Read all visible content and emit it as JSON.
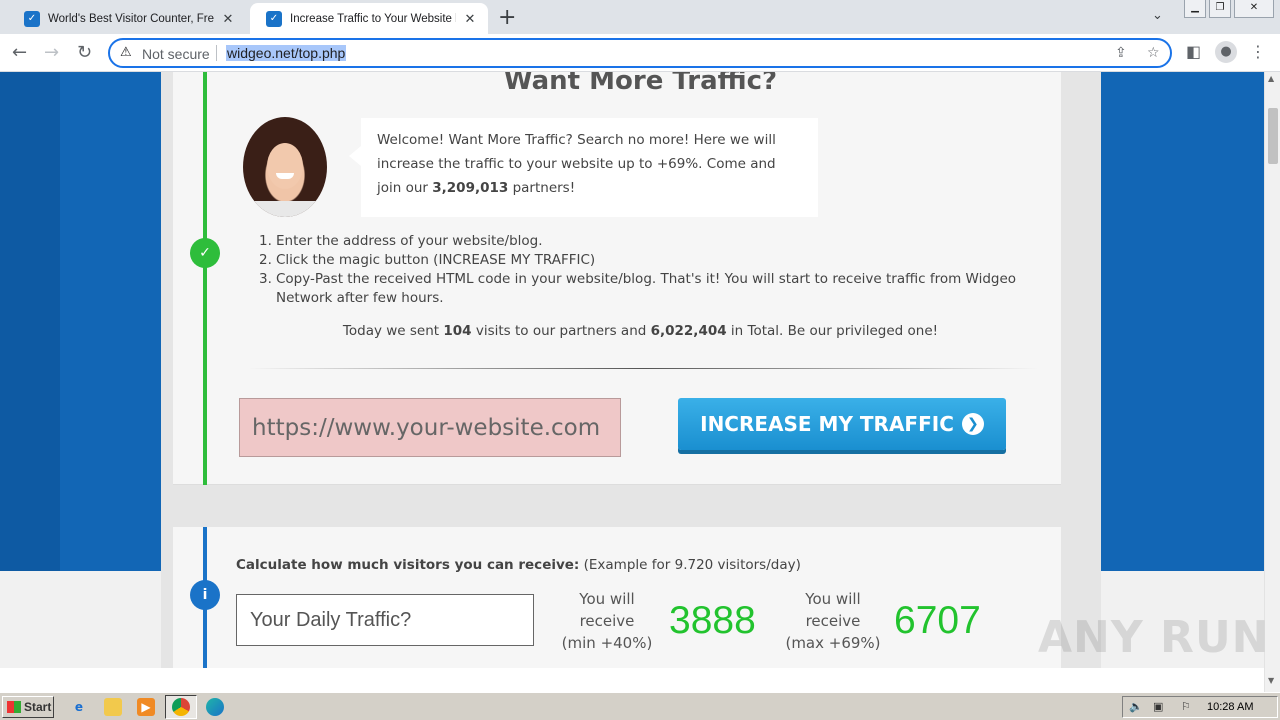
{
  "browser": {
    "tabs": [
      {
        "title": "World's Best Visitor Counter, Free hi",
        "active": false
      },
      {
        "title": "Increase Traffic to Your Website by",
        "active": true
      }
    ],
    "new_tab_label": "+",
    "security_label": "Not secure",
    "url": "widgeo.net/top.php"
  },
  "page": {
    "heading": "Want More Traffic?",
    "bubble": {
      "text_before": "Welcome! Want More Traffic? Search no more! Here we will increase the traffic to your website up to +69%. Come and join our ",
      "partners": "3,209,013",
      "text_after": " partners!"
    },
    "steps": [
      {
        "num": "1.",
        "text": "Enter the address of your website/blog."
      },
      {
        "num": "2.",
        "text": "Click the magic button (INCREASE MY TRAFFIC)"
      },
      {
        "num": "3.",
        "text": "Copy-Past the received HTML code in your website/blog. That's it! You will start to receive traffic from Widgeo Network after few hours."
      }
    ],
    "stats": {
      "prefix": "Today we sent ",
      "today": "104",
      "middle": " visits to our partners and ",
      "total": "6,022,404",
      "suffix": " in Total. Be our privileged one!"
    },
    "url_input_placeholder": "https://www.your-website.com",
    "increase_button": "INCREASE MY TRAFFIC",
    "calculator": {
      "title": "Calculate how much visitors you can receive:",
      "example": " (Example for 9.720 visitors/day)",
      "daily_placeholder": "Your Daily Traffic?",
      "min_label": [
        "You will",
        "receive",
        "(min +40%)"
      ],
      "min_value": "3888",
      "max_label": [
        "You will",
        "receive",
        "(max +69%)"
      ],
      "max_value": "6707"
    }
  },
  "watermark": "ANY RUN",
  "taskbar": {
    "start_label": "Start",
    "clock": "10:28 AM"
  },
  "colors": {
    "accent_blue": "#1266b5",
    "success_green": "#2ebd3b",
    "number_green": "#22c32e",
    "button_blue": "#1a8fd0"
  }
}
